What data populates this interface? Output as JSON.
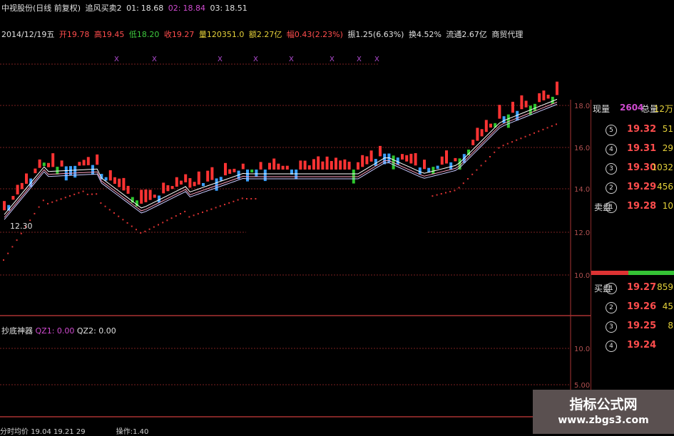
{
  "header": {
    "line1": [
      "中视股份(日线 前复权)",
      "追风买卖2",
      "01:",
      "18.68",
      "02:",
      "18.84",
      "03:",
      "18.51"
    ],
    "line2": {
      "date": "2014/12/19五",
      "open": "开19.78",
      "high": "高19.45",
      "low": "低18.20",
      "close": "收19.27",
      "volume": "量120351.0",
      "amount": "额2.27亿",
      "change": "幅0.43(2.23%)",
      "amp": "振1.25(6.63%)",
      "turnover": "换4.52%",
      "float": "流通2.67亿",
      "sector": "商贸代理"
    }
  },
  "price_axis": [
    "18.00",
    "16.00",
    "14.00",
    "12.00",
    "10.00"
  ],
  "lower_axis": [
    "10.00",
    "5.00"
  ],
  "low_price_label": "12.30",
  "lower_header": {
    "name": "抄底神器",
    "q1": "QZ1: 0.00",
    "q2": "QZ2: 0.00"
  },
  "panel_top": {
    "a": "现量",
    "b": "2604",
    "c": "总量",
    "d": "12万"
  },
  "sell_rows": [
    {
      "label": "",
      "n": "5",
      "price": "19.32",
      "vol": "51"
    },
    {
      "label": "",
      "n": "4",
      "price": "19.31",
      "vol": "29"
    },
    {
      "label": "",
      "n": "3",
      "price": "19.30",
      "vol": "1032"
    },
    {
      "label": "",
      "n": "2",
      "price": "19.29",
      "vol": "456"
    },
    {
      "label": "卖盘",
      "n": "1",
      "price": "19.28",
      "vol": "10"
    }
  ],
  "buy_rows": [
    {
      "label": "买盘",
      "n": "1",
      "price": "19.27",
      "vol": "859"
    },
    {
      "label": "",
      "n": "2",
      "price": "19.26",
      "vol": "45"
    },
    {
      "label": "",
      "n": "3",
      "price": "19.25",
      "vol": "8"
    },
    {
      "label": "",
      "n": "4",
      "price": "19.24",
      "vol": ""
    }
  ],
  "watermark": {
    "line1": "指标公式网",
    "line2": "www.zbgs3.com"
  },
  "footer": [
    "分时均价",
    "19.04",
    "19.21",
    "29",
    "操作:1.40"
  ],
  "colors": {
    "up": "#ff3333",
    "down": "#2ec72e",
    "grid": "#7a1f1f",
    "ma_white": "#ffffff",
    "ma_pink": "#ff9fbf"
  }
}
